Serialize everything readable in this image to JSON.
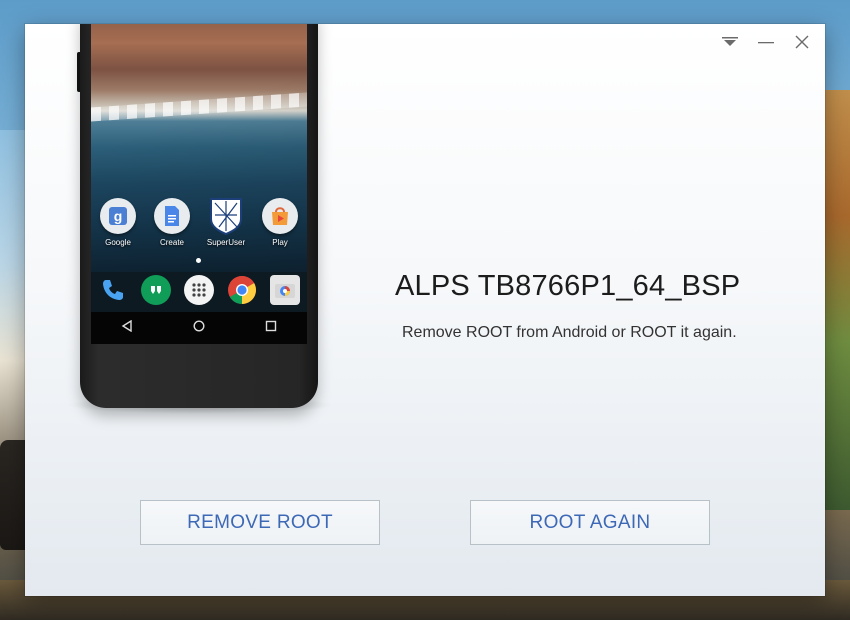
{
  "window": {
    "controls": [
      "menu-icon",
      "minimize-icon",
      "close-icon"
    ]
  },
  "phone": {
    "apps": [
      {
        "label": "Google",
        "icon": "google-icon"
      },
      {
        "label": "Create",
        "icon": "docs-icon"
      },
      {
        "label": "SuperUser",
        "icon": "superuser-icon"
      },
      {
        "label": "Play",
        "icon": "play-store-icon"
      }
    ],
    "dock": [
      "phone-icon",
      "hangouts-icon",
      "app-drawer-icon",
      "chrome-icon",
      "camera-icon"
    ],
    "nav": [
      "back-icon",
      "home-icon",
      "recents-icon"
    ]
  },
  "device": {
    "name": "ALPS TB8766P1_64_BSP",
    "subtitle": "Remove ROOT from Android or ROOT it again."
  },
  "actions": {
    "remove_label": "REMOVE ROOT",
    "again_label": "ROOT AGAIN"
  },
  "colors": {
    "accent_text": "#3d68b6",
    "button_border": "#b8c0c8"
  }
}
